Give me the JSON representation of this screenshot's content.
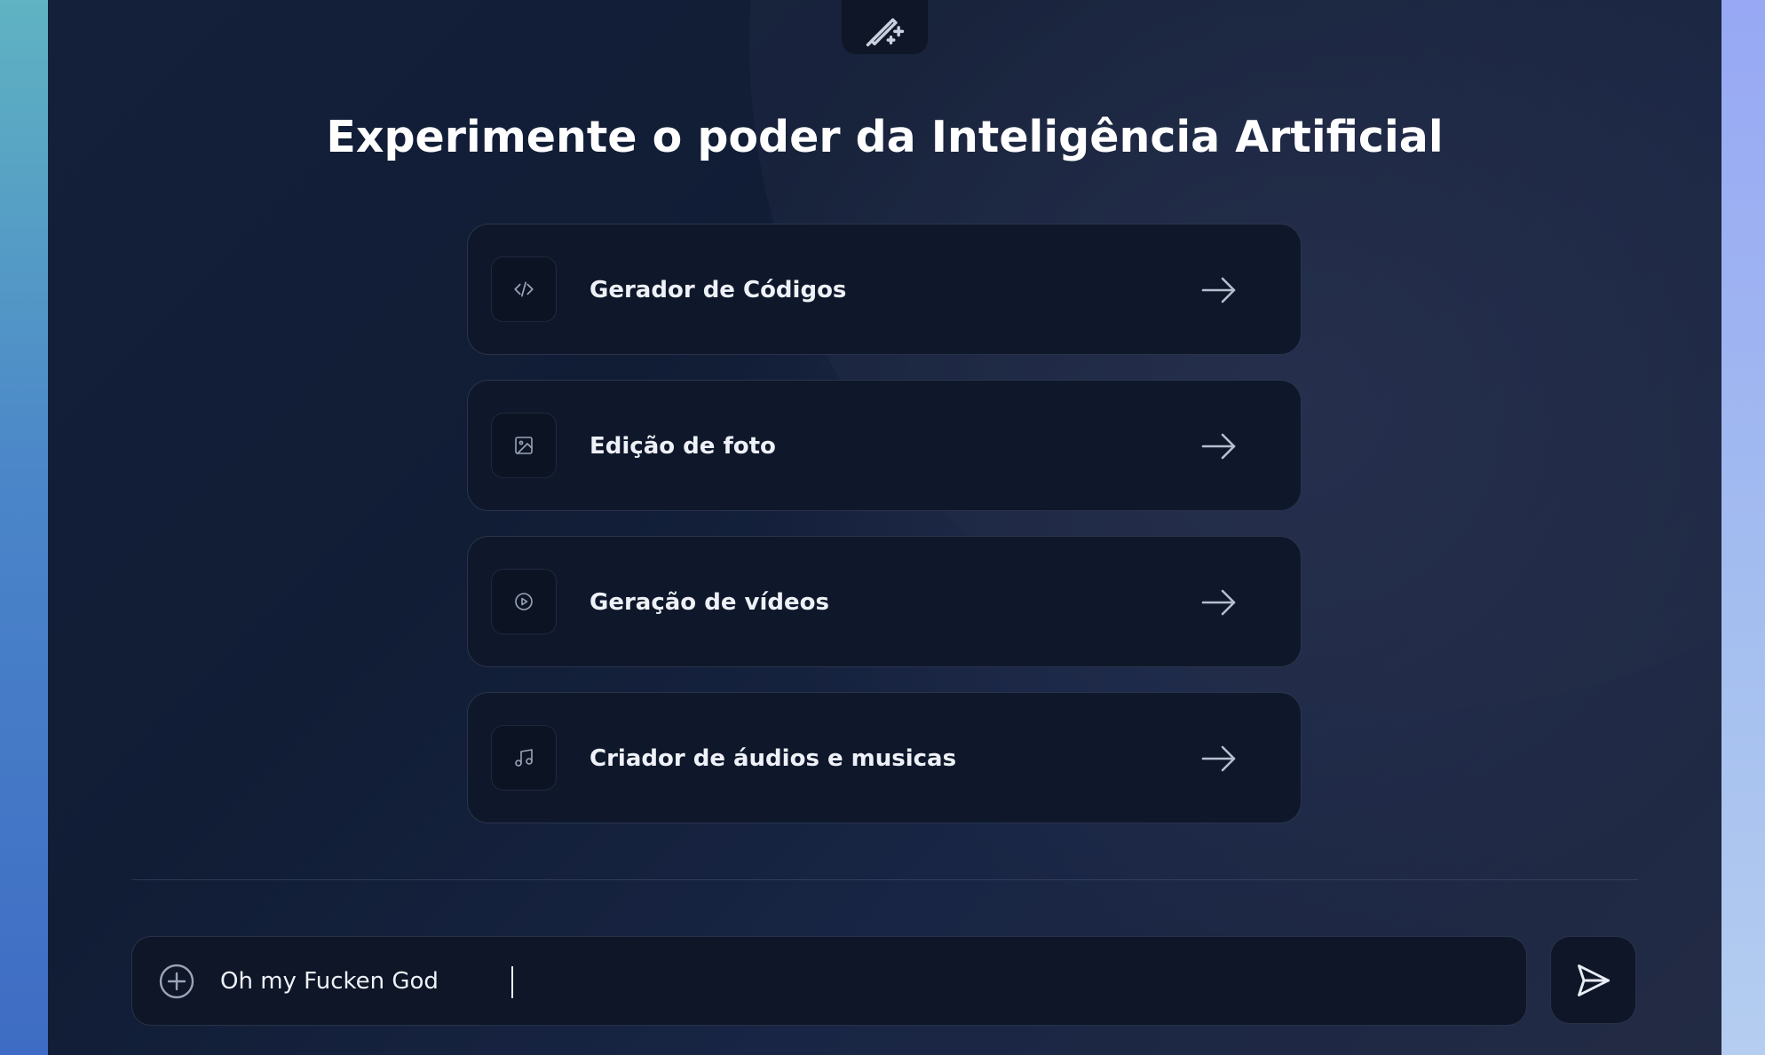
{
  "header": {
    "badge_icon": "magic-wand-sparkles-icon",
    "title": "Experimente o poder da Inteligência Artificial"
  },
  "options": [
    {
      "label": "Gerador de Códigos",
      "icon": "code-icon"
    },
    {
      "label": "Edição de foto",
      "icon": "image-icon"
    },
    {
      "label": "Geração de vídeos",
      "icon": "play-circle-icon"
    },
    {
      "label": "Criador de áudios e musicas",
      "icon": "music-note-icon"
    }
  ],
  "composer": {
    "add_icon": "plus-circle-icon",
    "input_value": "Oh my Fucken God",
    "send_icon": "send-icon"
  },
  "colors": {
    "panel_bg": "#111d35",
    "card_bg": "#0f182b",
    "text": "#eef1f7",
    "icon_stroke": "#9aa4b8"
  }
}
